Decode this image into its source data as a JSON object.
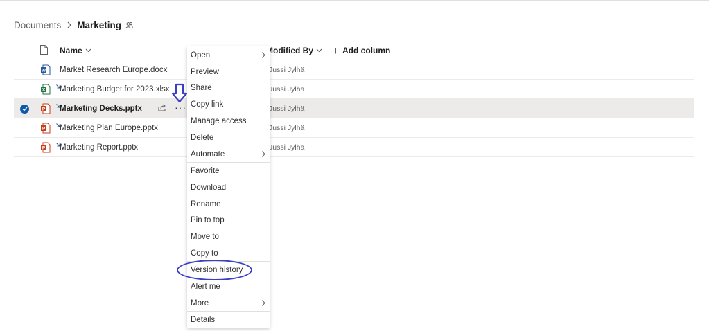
{
  "breadcrumb": {
    "root": "Documents",
    "current": "Marketing"
  },
  "columns": {
    "name": "Name",
    "modified_by": "Modified By",
    "add_column": "Add column"
  },
  "files": [
    {
      "name": "Market Research Europe.docx",
      "type": "word",
      "modified_by": "Jussi Jylhä",
      "selected": false,
      "synced": false
    },
    {
      "name": "Marketing Budget for 2023.xlsx",
      "type": "excel",
      "modified_by": "Jussi Jylhä",
      "selected": false,
      "synced": true
    },
    {
      "name": "Marketing Decks.pptx",
      "type": "powerpoint",
      "modified_by": "Jussi Jylhä",
      "selected": true,
      "synced": true
    },
    {
      "name": "Marketing Plan Europe.pptx",
      "type": "powerpoint",
      "modified_by": "Jussi Jylhä",
      "selected": false,
      "synced": true
    },
    {
      "name": "Marketing Report.pptx",
      "type": "powerpoint",
      "modified_by": "Jussi Jylhä",
      "selected": false,
      "synced": true
    }
  ],
  "row_actions": {
    "more": "···"
  },
  "context_menu": {
    "items": [
      {
        "label": "Open",
        "submenu": true
      },
      {
        "label": "Preview",
        "submenu": false
      },
      {
        "label": "Share",
        "submenu": false
      },
      {
        "label": "Copy link",
        "submenu": false
      },
      {
        "label": "Manage access",
        "submenu": false
      },
      {
        "label": "Delete",
        "submenu": false
      },
      {
        "label": "Automate",
        "submenu": true
      },
      {
        "label": "Favorite",
        "submenu": false
      },
      {
        "label": "Download",
        "submenu": false
      },
      {
        "label": "Rename",
        "submenu": false
      },
      {
        "label": "Pin to top",
        "submenu": false
      },
      {
        "label": "Move to",
        "submenu": false
      },
      {
        "label": "Copy to",
        "submenu": false
      },
      {
        "label": "Version history",
        "submenu": false,
        "highlighted": true
      },
      {
        "label": "Alert me",
        "submenu": false
      },
      {
        "label": "More",
        "submenu": true
      },
      {
        "label": "Details",
        "submenu": false
      }
    ]
  },
  "colors": {
    "word": "#2b579a",
    "excel": "#217346",
    "powerpoint": "#c43e1c",
    "selected_check": "#0f5aa8",
    "annotation": "#3b3fc4"
  }
}
